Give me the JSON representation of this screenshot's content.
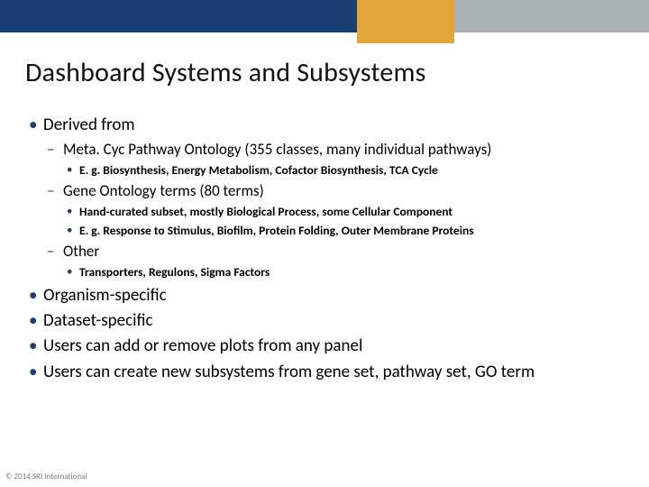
{
  "title": "Dashboard Systems and Subsystems",
  "bullets": {
    "b1": "Derived from",
    "b1_1": "Meta. Cyc Pathway Ontology (355 classes, many individual pathways)",
    "b1_1_1": "E. g. Biosynthesis, Energy Metabolism, Cofactor Biosynthesis, TCA Cycle",
    "b1_2": "Gene Ontology terms (80 terms)",
    "b1_2_1": "Hand-curated subset, mostly Biological Process, some Cellular Component",
    "b1_2_2": "E. g. Response to Stimulus, Biofilm, Protein Folding, Outer Membrane Proteins",
    "b1_3": "Other",
    "b1_3_1": "Transporters, Regulons, Sigma Factors",
    "b2": "Organism-specific",
    "b3": "Dataset-specific",
    "b4": "Users can add or remove plots from any panel",
    "b5": "Users can create new subsystems from gene set, pathway set, GO term"
  },
  "footer": "© 2014 SRI International",
  "colors": {
    "navy": "#1a3d73",
    "gold": "#e2a537",
    "grey": "#aab2b6"
  }
}
